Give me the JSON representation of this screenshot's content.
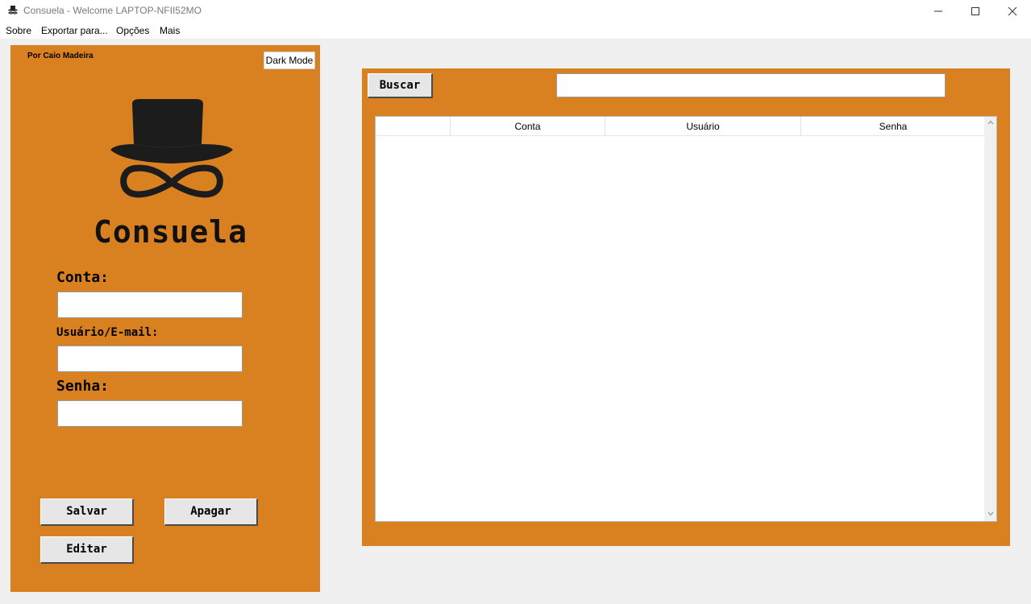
{
  "window": {
    "title": "Consuela - Welcome LAPTOP-NFII52MO"
  },
  "menu": {
    "items": [
      "Sobre",
      "Exportar para...",
      "Opções",
      "Mais"
    ]
  },
  "left_panel": {
    "author": "Por Caio Madeira",
    "dark_mode_label": "Dark Mode",
    "app_name": "Consuela",
    "conta_label": "Conta:",
    "usuario_label": "Usuário/E-mail:",
    "senha_label": "Senha:",
    "conta_value": "",
    "usuario_value": "",
    "senha_value": "",
    "save_label": "Salvar",
    "delete_label": "Apagar",
    "edit_label": "Editar"
  },
  "right_panel": {
    "search_label": "Buscar",
    "search_value": "",
    "table": {
      "columns": [
        "",
        "Conta",
        "Usuário",
        "Senha"
      ],
      "rows": []
    }
  },
  "colors": {
    "accent": "#d98020",
    "background": "#f0f0f0",
    "button": "#e6e6e6"
  },
  "icons": {
    "app": "top-hat-mustache-icon",
    "minimize": "minimize-icon",
    "maximize": "maximize-icon",
    "close": "close-icon"
  }
}
